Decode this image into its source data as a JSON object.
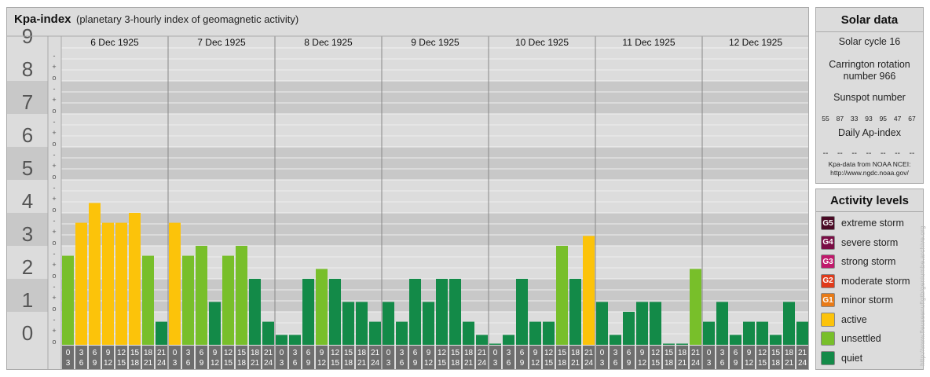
{
  "header": {
    "title": "Kpa-index",
    "subtitle": "(planetary 3-hourly index of geomagnetic activity)"
  },
  "chart_data": {
    "type": "bar",
    "title": "Kpa-index",
    "subtitle": "(planetary 3-hourly index of geomagnetic activity)",
    "ylim": [
      0,
      9
    ],
    "y_ticks": [
      "0",
      "1",
      "2",
      "3",
      "4",
      "5",
      "6",
      "7",
      "8",
      "9"
    ],
    "minor_marks": [
      "o",
      "+",
      "-"
    ],
    "days": [
      "6 Dec 1925",
      "7 Dec 1925",
      "8 Dec 1925",
      "9 Dec 1925",
      "10 Dec 1925",
      "11 Dec 1925",
      "12 Dec 1925"
    ],
    "interval_top": [
      "0",
      "3",
      "6",
      "9",
      "12",
      "15",
      "18",
      "21"
    ],
    "interval_bottom": [
      "3",
      "6",
      "9",
      "12",
      "15",
      "18",
      "21",
      "24"
    ],
    "values": [
      [
        2.7,
        3.7,
        4.3,
        3.7,
        3.7,
        4.0,
        2.7,
        0.7
      ],
      [
        3.7,
        2.7,
        3.0,
        1.3,
        2.7,
        3.0,
        2.0,
        0.7
      ],
      [
        0.3,
        0.3,
        2.0,
        2.3,
        2.0,
        1.3,
        1.3,
        0.7
      ],
      [
        1.3,
        0.7,
        2.0,
        1.3,
        2.0,
        2.0,
        0.7,
        0.3
      ],
      [
        0.0,
        0.3,
        2.0,
        0.7,
        0.7,
        3.0,
        2.0,
        3.3
      ],
      [
        1.3,
        0.3,
        1.0,
        1.3,
        1.3,
        0.0,
        0.0,
        2.3
      ],
      [
        0.7,
        1.3,
        0.3,
        0.7,
        0.7,
        0.3,
        1.3,
        0.7
      ]
    ],
    "levels": {
      "quiet": {
        "max": 2,
        "color": "#138a48"
      },
      "unsettled": {
        "max": 3,
        "color": "#78bf2a"
      },
      "active": {
        "max": 4.5,
        "color": "#fcc30a"
      }
    },
    "grid": true
  },
  "solar": {
    "title": "Solar data",
    "cycle": "Solar cycle 16",
    "carrington_line1": "Carrington rotation",
    "carrington_line2": "number 966",
    "sunspot_label": "Sunspot number",
    "sunspots": [
      "55",
      "87",
      "33",
      "93",
      "95",
      "47",
      "67"
    ],
    "ap_label": "Daily Ap-index",
    "ap_values": [
      "--",
      "--",
      "--",
      "--",
      "--",
      "--",
      "--"
    ],
    "source_line1": "Kpa-data from NOAA NCEI:",
    "source_line2": "http://www.ngdc.noaa.gov/"
  },
  "activity": {
    "title": "Activity levels",
    "items": [
      {
        "badge": "G5",
        "label": "extreme storm",
        "color": "#4a0a25"
      },
      {
        "badge": "G4",
        "label": "severe storm",
        "color": "#7a0d45"
      },
      {
        "badge": "G3",
        "label": "strong storm",
        "color": "#c0196b"
      },
      {
        "badge": "G2",
        "label": "moderate storm",
        "color": "#e03a1a"
      },
      {
        "badge": "G1",
        "label": "minor storm",
        "color": "#e87a16"
      },
      {
        "badge": "",
        "label": "active",
        "color": "#fcc30a"
      },
      {
        "badge": "",
        "label": "unsettled",
        "color": "#78bf2a"
      },
      {
        "badge": "",
        "label": "quiet",
        "color": "#138a48"
      }
    ]
  },
  "watermark": "http://www.fleuseenuflgtb/geniumbe.archive.org"
}
